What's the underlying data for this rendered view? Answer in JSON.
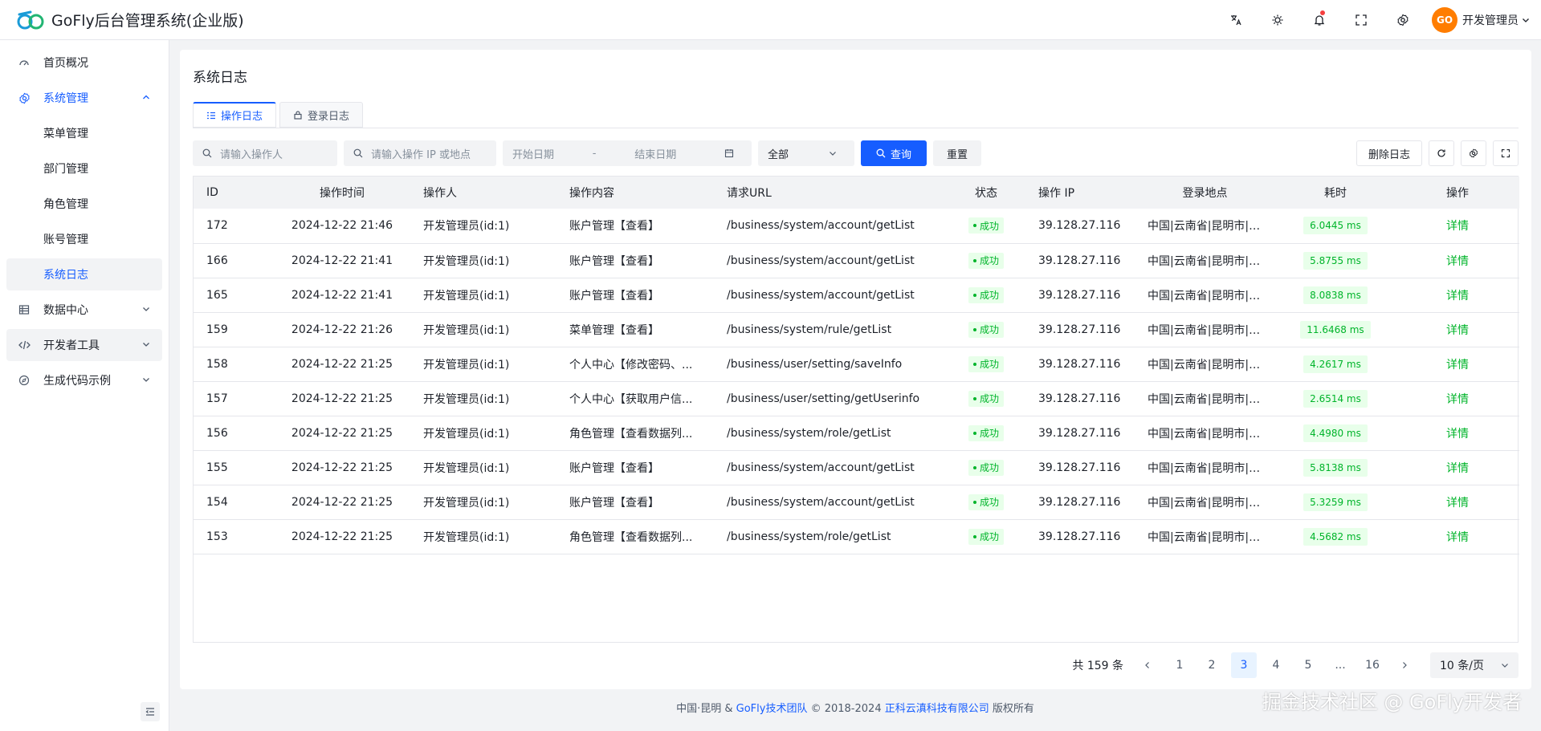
{
  "header": {
    "title": "GoFly后台管理系统(企业版)",
    "user_name": "开发管理员",
    "avatar_text": "GO",
    "icons": [
      "translate-icon",
      "theme-icon",
      "bell-icon",
      "fullscreen-icon",
      "settings-icon"
    ]
  },
  "sidebar": {
    "home": "首页概况",
    "system": "系统管理",
    "sub": [
      "菜单管理",
      "部门管理",
      "角色管理",
      "账号管理",
      "系统日志"
    ],
    "data_center": "数据中心",
    "dev_tools": "开发者工具",
    "codegen": "生成代码示例"
  },
  "page": {
    "title": "系统日志",
    "tab_operation": "操作日志",
    "tab_login": "登录日志"
  },
  "filters": {
    "operator_placeholder": "请输入操作人",
    "ip_placeholder": "请输入操作 IP 或地点",
    "start_date": "开始日期",
    "date_sep": "-",
    "end_date": "结束日期",
    "select_value": "全部",
    "search_label": "查询",
    "reset_label": "重置",
    "delete_label": "删除日志"
  },
  "table": {
    "headers": [
      "ID",
      "操作时间",
      "操作人",
      "操作内容",
      "请求URL",
      "状态",
      "操作 IP",
      "登录地点",
      "耗时",
      "操作"
    ],
    "rows": [
      {
        "id": "172",
        "time": "2024-12-22 21:46",
        "user": "开发管理员(id:1)",
        "content": "账户管理【查看】",
        "url": "/business/system/account/getList",
        "status": "成功",
        "ip": "39.128.27.116",
        "location": "中国|云南省|昆明市|移动",
        "cost": "6.0445 ms",
        "action": "详情"
      },
      {
        "id": "166",
        "time": "2024-12-22 21:41",
        "user": "开发管理员(id:1)",
        "content": "账户管理【查看】",
        "url": "/business/system/account/getList",
        "status": "成功",
        "ip": "39.128.27.116",
        "location": "中国|云南省|昆明市|移动",
        "cost": "5.8755 ms",
        "action": "详情"
      },
      {
        "id": "165",
        "time": "2024-12-22 21:41",
        "user": "开发管理员(id:1)",
        "content": "账户管理【查看】",
        "url": "/business/system/account/getList",
        "status": "成功",
        "ip": "39.128.27.116",
        "location": "中国|云南省|昆明市|移动",
        "cost": "8.0838 ms",
        "action": "详情"
      },
      {
        "id": "159",
        "time": "2024-12-22 21:26",
        "user": "开发管理员(id:1)",
        "content": "菜单管理【查看】",
        "url": "/business/system/rule/getList",
        "status": "成功",
        "ip": "39.128.27.116",
        "location": "中国|云南省|昆明市|移动",
        "cost": "11.6468 ms",
        "action": "详情"
      },
      {
        "id": "158",
        "time": "2024-12-22 21:25",
        "user": "开发管理员(id:1)",
        "content": "个人中心【修改密码、...",
        "url": "/business/user/setting/saveInfo",
        "status": "成功",
        "ip": "39.128.27.116",
        "location": "中国|云南省|昆明市|移动",
        "cost": "4.2617 ms",
        "action": "详情"
      },
      {
        "id": "157",
        "time": "2024-12-22 21:25",
        "user": "开发管理员(id:1)",
        "content": "个人中心【获取用户信...",
        "url": "/business/user/setting/getUserinfo",
        "status": "成功",
        "ip": "39.128.27.116",
        "location": "中国|云南省|昆明市|移动",
        "cost": "2.6514 ms",
        "action": "详情"
      },
      {
        "id": "156",
        "time": "2024-12-22 21:25",
        "user": "开发管理员(id:1)",
        "content": "角色管理【查看数据列...",
        "url": "/business/system/role/getList",
        "status": "成功",
        "ip": "39.128.27.116",
        "location": "中国|云南省|昆明市|移动",
        "cost": "4.4980 ms",
        "action": "详情"
      },
      {
        "id": "155",
        "time": "2024-12-22 21:25",
        "user": "开发管理员(id:1)",
        "content": "账户管理【查看】",
        "url": "/business/system/account/getList",
        "status": "成功",
        "ip": "39.128.27.116",
        "location": "中国|云南省|昆明市|移动",
        "cost": "5.8138 ms",
        "action": "详情"
      },
      {
        "id": "154",
        "time": "2024-12-22 21:25",
        "user": "开发管理员(id:1)",
        "content": "账户管理【查看】",
        "url": "/business/system/account/getList",
        "status": "成功",
        "ip": "39.128.27.116",
        "location": "中国|云南省|昆明市|移动",
        "cost": "5.3259 ms",
        "action": "详情"
      },
      {
        "id": "153",
        "time": "2024-12-22 21:25",
        "user": "开发管理员(id:1)",
        "content": "角色管理【查看数据列...",
        "url": "/business/system/role/getList",
        "status": "成功",
        "ip": "39.128.27.116",
        "location": "中国|云南省|昆明市|移动",
        "cost": "4.5682 ms",
        "action": "详情"
      }
    ]
  },
  "pagination": {
    "total": "共 159 条",
    "pages": [
      "1",
      "2",
      "3",
      "4",
      "5",
      "...",
      "16"
    ],
    "current": "3",
    "page_size": "10 条/页"
  },
  "footer": {
    "prefix": "中国·昆明 &",
    "team": "GoFly技术团队",
    "copyright": "© 2018-2024",
    "company": "正科云滇科技有限公司",
    "suffix": "版权所有"
  },
  "watermark": "掘金技术社区 @ GoFly开发者",
  "colors": {
    "primary": "#165dff",
    "success": "#00b42a",
    "success_bg": "#e8ffea",
    "accent_orange": "#ff7d00"
  }
}
